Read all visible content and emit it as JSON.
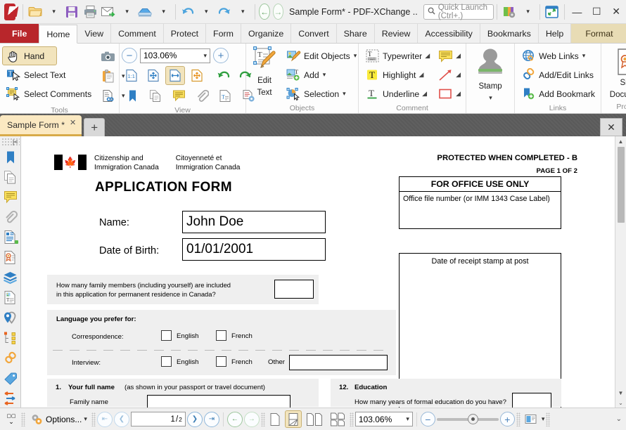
{
  "titlebar": {
    "app_logo": "pdfxchange-logo",
    "open_label": "Open",
    "save_label": "Save",
    "print_label": "Print",
    "email_label": "Email",
    "scan_label": "Scan",
    "undo_label": "Undo",
    "redo_label": "Redo",
    "back_label": "Back",
    "forward_label": "Forward",
    "document_title": "Sample Form* - PDF-XChange ..",
    "quick_launch_placeholder": "Quick Launch (Ctrl+.)",
    "theme_label": "Themes",
    "fullscreen_label": "Full Screen",
    "minimize": "—",
    "maximize": "☐",
    "close": "✕"
  },
  "ribbon_tabs": [
    {
      "label": "File",
      "state": "file"
    },
    {
      "label": "Home",
      "state": "active"
    },
    {
      "label": "View",
      "state": "normal"
    },
    {
      "label": "Comment",
      "state": "normal"
    },
    {
      "label": "Protect",
      "state": "normal"
    },
    {
      "label": "Form",
      "state": "normal"
    },
    {
      "label": "Organize",
      "state": "normal"
    },
    {
      "label": "Convert",
      "state": "normal"
    },
    {
      "label": "Share",
      "state": "normal"
    },
    {
      "label": "Review",
      "state": "normal"
    },
    {
      "label": "Accessibility",
      "state": "normal"
    },
    {
      "label": "Bookmarks",
      "state": "normal"
    },
    {
      "label": "Help",
      "state": "normal"
    },
    {
      "label": "Format",
      "state": "context"
    }
  ],
  "ribbon": {
    "groups": {
      "tools": {
        "title": "Tools",
        "hand": "Hand",
        "select_text": "Select Text",
        "select_comments": "Select Comments",
        "snapshot": "Snapshot",
        "clipboard": "Clipboard",
        "find": "Find"
      },
      "view": {
        "title": "View",
        "zoom_out": "Zoom Out",
        "zoom_value": "103.06%",
        "zoom_in": "Zoom In",
        "actual_size": "1:1",
        "fit_page": "Fit Page",
        "fit_width": "Fit Width",
        "fit_visible": "Fit Visible",
        "rotate_ccw": "Rotate Counterclockwise",
        "rotate_cw": "Rotate Clockwise",
        "bookmarks": "Bookmarks",
        "pages": "Pages",
        "comments": "Comments",
        "attachments": "Attachments",
        "content": "Content",
        "properties": "Properties"
      },
      "objects": {
        "title": "Objects",
        "edit_text": "Edit\nText",
        "edit_text_line1": "Edit",
        "edit_text_line2": "Text",
        "edit_objects": "Edit Objects",
        "add": "Add",
        "selection": "Selection"
      },
      "comment": {
        "title": "Comment",
        "typewriter": "Typewriter",
        "highlight": "Highlight",
        "underline": "Underline",
        "sticky_note": "Sticky Note",
        "arrow": "Arrow",
        "rectangle": "Rectangle"
      },
      "stamp": {
        "title": "",
        "label_line1": "Stamp"
      },
      "links": {
        "title": "Links",
        "web_links": "Web Links",
        "add_edit_links": "Add/Edit Links",
        "add_bookmark": "Add Bookmark"
      },
      "protect": {
        "title": "Protect",
        "sign_line1": "Sign",
        "sign_line2": "Document"
      }
    }
  },
  "tabstrip": {
    "document_tab": "Sample Form *",
    "tab_close": "✕",
    "new_tab": "+",
    "panel_close": "✕"
  },
  "navpane": {
    "items": [
      {
        "name": "bookmarks-icon",
        "label": "Bookmarks"
      },
      {
        "name": "pages-icon",
        "label": "Pages"
      },
      {
        "name": "comments-icon",
        "label": "Comments"
      },
      {
        "name": "attachments-icon",
        "label": "Attachments"
      },
      {
        "name": "fields-icon",
        "label": "Fields"
      },
      {
        "name": "signatures-icon",
        "label": "Signatures"
      },
      {
        "name": "layers-icon",
        "label": "Layers"
      },
      {
        "name": "content-icon",
        "label": "Content"
      },
      {
        "name": "destinations-icon",
        "label": "Destinations"
      },
      {
        "name": "structure-icon",
        "label": "Structure"
      },
      {
        "name": "links-icon",
        "label": "Links"
      },
      {
        "name": "stamps-icon",
        "label": "Stamps"
      },
      {
        "name": "zoom-tool-icon",
        "label": "Zoom"
      }
    ]
  },
  "document": {
    "dept_en": "Citizenship and\nImmigration Canada",
    "dept_en_l1": "Citizenship and",
    "dept_en_l2": "Immigration Canada",
    "dept_fr_l1": "Citoyenneté et",
    "dept_fr_l2": "Immigration Canada",
    "title": "APPLICATION FORM",
    "protected_notice": "PROTECTED WHEN COMPLETED - B",
    "page_of": "PAGE 1 OF 2",
    "office_header": "FOR OFFICE USE ONLY",
    "office_body": "Office file number (or IMM 1343 Case Label)",
    "stamp_box_label": "Date of receipt stamp at post",
    "name_label": "Name:",
    "name_value": "John Doe",
    "dob_label": "Date of Birth:",
    "dob_value": "01/01/2001",
    "family_question_l1": "How many family members (including yourself) are included",
    "family_question_l2": "in this application for permanent residence in Canada?",
    "family_count_value": "",
    "language_header": "Language you prefer for:",
    "correspondence_label": "Correspondence:",
    "interview_label": "Interview:",
    "english_label": "English",
    "french_label": "French",
    "other_label": "Other",
    "other_value": "",
    "q1_number": "1.",
    "q1_title": "Your full name",
    "q1_hint": "(as shown in your passport or travel document)",
    "q1_family_name_label": "Family name",
    "q1_family_name_value": "",
    "q12_number": "12.",
    "q12_title": "Education",
    "q12_question": "How many years of formal education do you have?",
    "q12_value": ""
  },
  "statusbar": {
    "collapse_label": "Collapse",
    "options_label": "Options...",
    "first_page": "First Page",
    "prev_page": "Previous Page",
    "page_current": "1",
    "page_separator": "/",
    "page_total": "2",
    "next_page": "Next Page",
    "last_page": "Last Page",
    "nav_back": "Go Back",
    "nav_forward": "Go Forward",
    "single_page": "Single Page",
    "continuous": "Continuous",
    "two_pages": "Two Pages",
    "four_pages": "Four Pages",
    "zoom_value": "103.06%",
    "zoom_out": "Zoom Out",
    "zoom_in": "Zoom In",
    "loupe": "Loupe"
  },
  "colors": {
    "brand_red": "#b8262b",
    "accent_tan": "#f2e4bd",
    "tab_gold": "#d8ab4a",
    "highlight_blue": "#dbe9f7"
  }
}
